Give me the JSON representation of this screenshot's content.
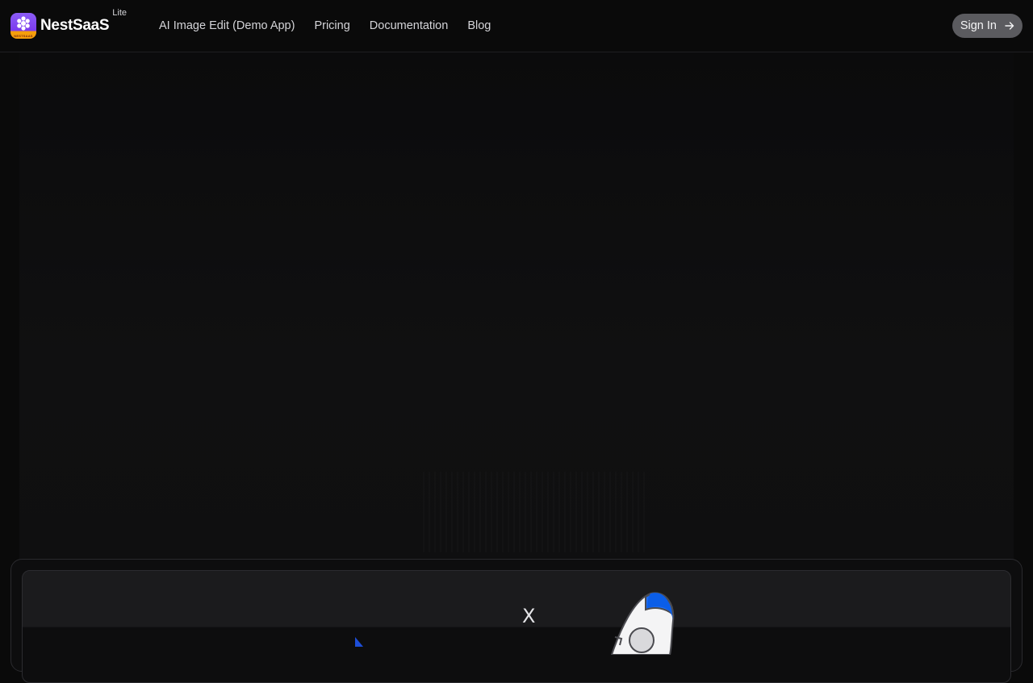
{
  "brand": {
    "name": "NestSaaS",
    "tag": "Lite",
    "logo_strip_text": "NESTSAAS",
    "logo_colors": {
      "top": "#8b5cf6",
      "bottom": "#f59e0b"
    }
  },
  "nav": {
    "items": [
      {
        "label": "AI Image Edit (Demo App)"
      },
      {
        "label": "Pricing"
      },
      {
        "label": "Documentation"
      },
      {
        "label": "Blog"
      }
    ]
  },
  "header": {
    "signin_label": "Sign In",
    "signin_icon": "arrow-right-icon"
  },
  "demo": {
    "close_glyph": "X",
    "icons": [
      "rocket-icon",
      "pointer-icon"
    ]
  },
  "colors": {
    "background": "#0a0a0a",
    "accent_blue": "#1d4ed8"
  }
}
